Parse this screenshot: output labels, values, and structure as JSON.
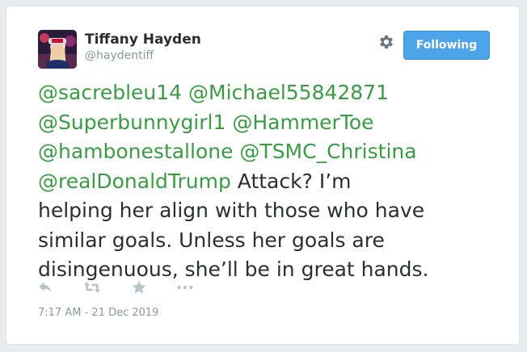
{
  "tweet": {
    "author": {
      "name": "Tiffany Hayden",
      "handle": "@haydentiff"
    },
    "follow_button_label": "Following",
    "lines": [
      [
        {
          "text": "@sacrebleu14",
          "type": "mention"
        },
        {
          "text": " ",
          "type": "text"
        },
        {
          "text": "@Michael55842871",
          "type": "mention"
        }
      ],
      [
        {
          "text": "@Superbunnygirl1",
          "type": "mention"
        },
        {
          "text": " ",
          "type": "text"
        },
        {
          "text": "@HammerToe",
          "type": "mention"
        }
      ],
      [
        {
          "text": "@hambonestallone",
          "type": "mention"
        },
        {
          "text": " ",
          "type": "text"
        },
        {
          "text": "@TSMC_Christina",
          "type": "mention"
        }
      ],
      [
        {
          "text": "@realDonaldTrump",
          "type": "mention"
        },
        {
          "text": " Attack? I’m",
          "type": "text"
        }
      ],
      [
        {
          "text": "helping her align with those who have",
          "type": "text"
        }
      ],
      [
        {
          "text": "similar goals. Unless her goals are",
          "type": "text"
        }
      ],
      [
        {
          "text": "disingenuous, she’ll be in great hands.",
          "type": "text"
        }
      ]
    ],
    "actions": [
      "reply-icon",
      "retweet-icon",
      "favorite-icon",
      "more-icon"
    ],
    "timestamp": "7:17 AM - 21 Dec 2019"
  },
  "colors": {
    "mention": "#3b9b45",
    "text": "#292f33",
    "muted": "#8899a6",
    "button": "#4ea4e8",
    "action_icon": "#b8c4cc"
  }
}
